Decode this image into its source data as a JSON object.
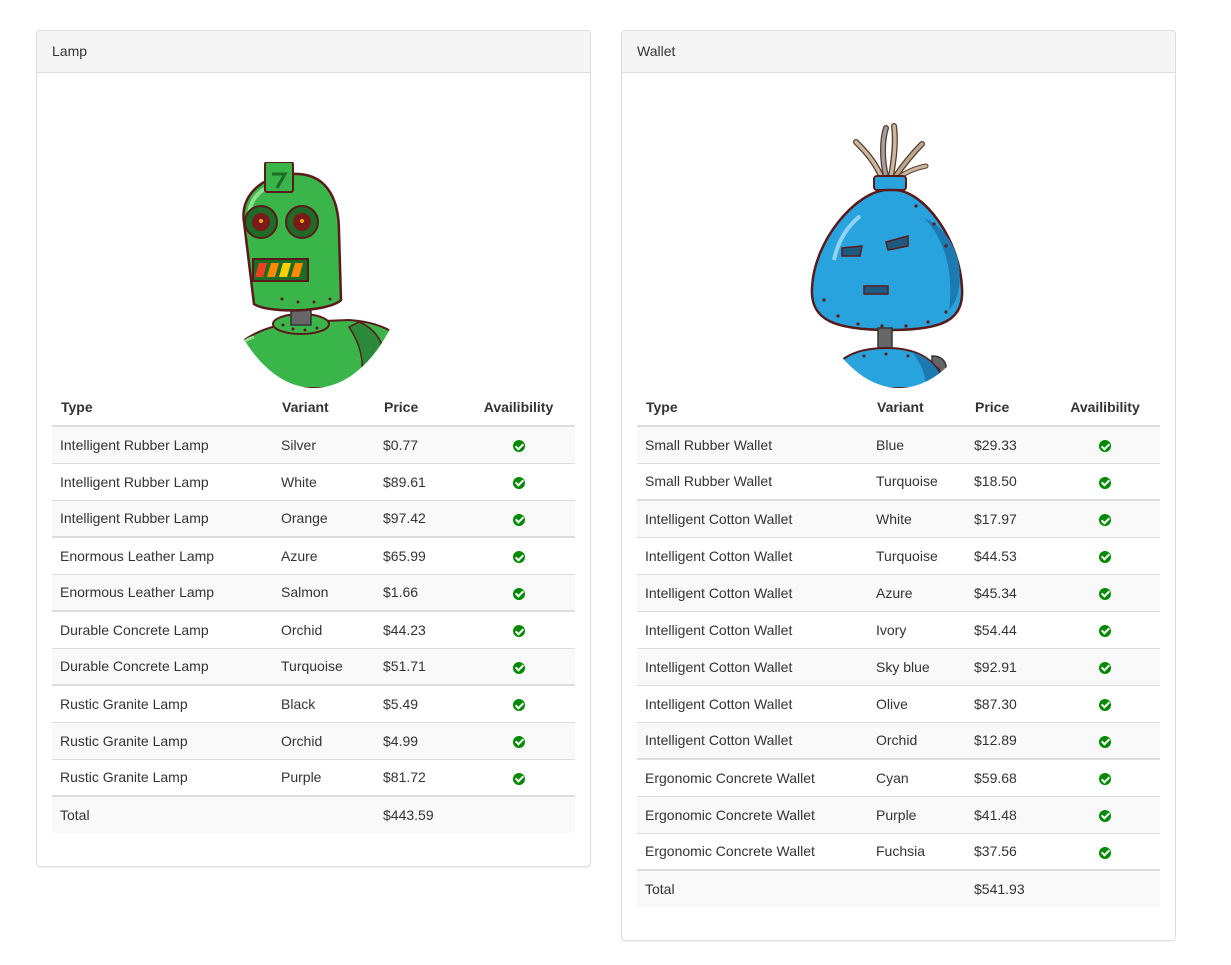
{
  "table_headers": {
    "type": "Type",
    "variant": "Variant",
    "price": "Price",
    "availability": "Availibility"
  },
  "colors": {
    "check": "#008a00",
    "panel_heading_bg": "#f5f5f5",
    "border": "#dddddd"
  },
  "panels": [
    {
      "title": "Lamp",
      "avatar_icon": "green-robot-avatar",
      "rows": [
        {
          "type": "Intelligent Rubber Lamp",
          "variant": "Silver",
          "price": "$0.77",
          "available": true
        },
        {
          "type": "Intelligent Rubber Lamp",
          "variant": "White",
          "price": "$89.61",
          "available": true
        },
        {
          "type": "Intelligent Rubber Lamp",
          "variant": "Orange",
          "price": "$97.42",
          "available": true
        },
        {
          "type": "Enormous Leather Lamp",
          "variant": "Azure",
          "price": "$65.99",
          "available": true
        },
        {
          "type": "Enormous Leather Lamp",
          "variant": "Salmon",
          "price": "$1.66",
          "available": true
        },
        {
          "type": "Durable Concrete Lamp",
          "variant": "Orchid",
          "price": "$44.23",
          "available": true
        },
        {
          "type": "Durable Concrete Lamp",
          "variant": "Turquoise",
          "price": "$51.71",
          "available": true
        },
        {
          "type": "Rustic Granite Lamp",
          "variant": "Black",
          "price": "$5.49",
          "available": true
        },
        {
          "type": "Rustic Granite Lamp",
          "variant": "Orchid",
          "price": "$4.99",
          "available": true
        },
        {
          "type": "Rustic Granite Lamp",
          "variant": "Purple",
          "price": "$81.72",
          "available": true
        }
      ],
      "total_label": "Total",
      "total_price": "$443.59"
    },
    {
      "title": "Wallet",
      "avatar_icon": "blue-robot-avatar",
      "rows": [
        {
          "type": "Small Rubber Wallet",
          "variant": "Blue",
          "price": "$29.33",
          "available": true
        },
        {
          "type": "Small Rubber Wallet",
          "variant": "Turquoise",
          "price": "$18.50",
          "available": true
        },
        {
          "type": "Intelligent Cotton Wallet",
          "variant": "White",
          "price": "$17.97",
          "available": true
        },
        {
          "type": "Intelligent Cotton Wallet",
          "variant": "Turquoise",
          "price": "$44.53",
          "available": true
        },
        {
          "type": "Intelligent Cotton Wallet",
          "variant": "Azure",
          "price": "$45.34",
          "available": true
        },
        {
          "type": "Intelligent Cotton Wallet",
          "variant": "Ivory",
          "price": "$54.44",
          "available": true
        },
        {
          "type": "Intelligent Cotton Wallet",
          "variant": "Sky blue",
          "price": "$92.91",
          "available": true
        },
        {
          "type": "Intelligent Cotton Wallet",
          "variant": "Olive",
          "price": "$87.30",
          "available": true
        },
        {
          "type": "Intelligent Cotton Wallet",
          "variant": "Orchid",
          "price": "$12.89",
          "available": true
        },
        {
          "type": "Ergonomic Concrete Wallet",
          "variant": "Cyan",
          "price": "$59.68",
          "available": true
        },
        {
          "type": "Ergonomic Concrete Wallet",
          "variant": "Purple",
          "price": "$41.48",
          "available": true
        },
        {
          "type": "Ergonomic Concrete Wallet",
          "variant": "Fuchsia",
          "price": "$37.56",
          "available": true
        }
      ],
      "total_label": "Total",
      "total_price": "$541.93"
    }
  ]
}
